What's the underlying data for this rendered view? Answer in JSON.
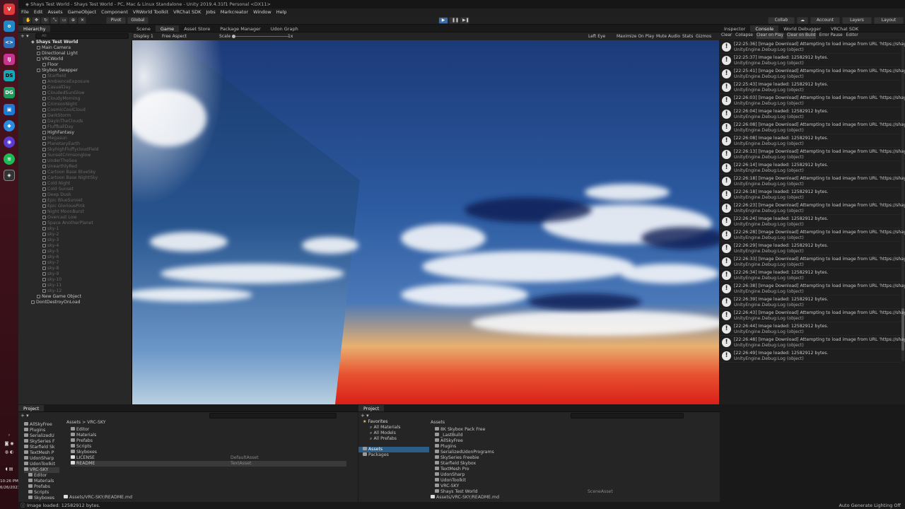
{
  "window_title": "Shays Test World - Shays Test World - PC, Mac & Linux Standalone - Unity 2019.4.31f1 Personal <DX11>",
  "menu": [
    "File",
    "Edit",
    "Assets",
    "GameObject",
    "Component",
    "VRWorld Toolkit",
    "VRChat SDK",
    "Jobs",
    "Markcreator",
    "Window",
    "Help"
  ],
  "toolbar": {
    "pivot_label": "Pivot",
    "global_label": "Global",
    "collab_label": "Collab",
    "account_label": "Account",
    "layers_label": "Layers",
    "layout_label": "Layout"
  },
  "hierarchy": {
    "tab_label": "Hierarchy",
    "search_placeholder": "All",
    "scene_name": "Shays Test World",
    "items": [
      {
        "label": "Main Camera",
        "indent": 2,
        "dim": false
      },
      {
        "label": "Directional Light",
        "indent": 2,
        "dim": false
      },
      {
        "label": "VRCWorld",
        "indent": 2,
        "dim": false
      },
      {
        "label": "Floor",
        "indent": 3,
        "dim": false
      },
      {
        "label": "Skybox Swapper",
        "indent": 2,
        "dim": false
      },
      {
        "label": "Starfield",
        "indent": 3,
        "dim": true
      },
      {
        "label": "AmbienceExposure",
        "indent": 3,
        "dim": true
      },
      {
        "label": "CasualDay",
        "indent": 3,
        "dim": true
      },
      {
        "label": "CloudedSunGlow",
        "indent": 3,
        "dim": true
      },
      {
        "label": "CloudyMorning",
        "indent": 3,
        "dim": true
      },
      {
        "label": "CrimsonNight",
        "indent": 3,
        "dim": true
      },
      {
        "label": "CosmicCoolCloud",
        "indent": 3,
        "dim": true
      },
      {
        "label": "DarkStorm",
        "indent": 3,
        "dim": true
      },
      {
        "label": "DayInTheClouds",
        "indent": 3,
        "dim": true
      },
      {
        "label": "FluffballDay",
        "indent": 3,
        "dim": true
      },
      {
        "label": "HighFantasy",
        "indent": 3,
        "dim": false
      },
      {
        "label": "Megasun",
        "indent": 3,
        "dim": true
      },
      {
        "label": "PlanetaryEarth",
        "indent": 3,
        "dim": true
      },
      {
        "label": "SkyhighFluffycloudField",
        "indent": 3,
        "dim": true
      },
      {
        "label": "SunsetCrimsonglow",
        "indent": 3,
        "dim": true
      },
      {
        "label": "UnderTheSea",
        "indent": 3,
        "dim": true
      },
      {
        "label": "UnearthlyRed",
        "indent": 3,
        "dim": true
      },
      {
        "label": "Cartoon Base BlueSky",
        "indent": 3,
        "dim": true
      },
      {
        "label": "Cartoon Base NightSky",
        "indent": 3,
        "dim": true
      },
      {
        "label": "Cold Night",
        "indent": 3,
        "dim": true
      },
      {
        "label": "Cold Sunset",
        "indent": 3,
        "dim": true
      },
      {
        "label": "Deep Dusk",
        "indent": 3,
        "dim": true
      },
      {
        "label": "Epic BlueSunset",
        "indent": 3,
        "dim": true
      },
      {
        "label": "Epic GloriousPink",
        "indent": 3,
        "dim": true
      },
      {
        "label": "Night MoonBurst",
        "indent": 3,
        "dim": true
      },
      {
        "label": "Overcast Low",
        "indent": 3,
        "dim": true
      },
      {
        "label": "Space AnotherPlanet",
        "indent": 3,
        "dim": true
      },
      {
        "label": "sky-1",
        "indent": 3,
        "dim": true
      },
      {
        "label": "sky-2",
        "indent": 3,
        "dim": true
      },
      {
        "label": "sky-3",
        "indent": 3,
        "dim": true
      },
      {
        "label": "sky-4",
        "indent": 3,
        "dim": true
      },
      {
        "label": "sky-5",
        "indent": 3,
        "dim": true
      },
      {
        "label": "sky-6",
        "indent": 3,
        "dim": true
      },
      {
        "label": "sky-7",
        "indent": 3,
        "dim": true
      },
      {
        "label": "sky-8",
        "indent": 3,
        "dim": true
      },
      {
        "label": "sky-9",
        "indent": 3,
        "dim": true
      },
      {
        "label": "sky-10",
        "indent": 3,
        "dim": true
      },
      {
        "label": "sky-11",
        "indent": 3,
        "dim": true
      },
      {
        "label": "sky-12",
        "indent": 3,
        "dim": true
      },
      {
        "label": "New Game Object",
        "indent": 2,
        "dim": false
      },
      {
        "label": "DontDestroyOnLoad",
        "indent": 1,
        "dim": false
      }
    ]
  },
  "view_tabs": [
    "Scene",
    "Game",
    "Asset Store",
    "Package Manager",
    "Udon Graph"
  ],
  "game_bar": {
    "display": "Display 1",
    "aspect": "Free Aspect",
    "scale_label": "Scale",
    "scale_value": "1x",
    "eye": "Left Eye",
    "maximize": "Maximize On Play",
    "mute": "Mute Audio",
    "stats": "Stats",
    "gizmos": "Gizmos"
  },
  "right_tabs": [
    "Inspector",
    "Console",
    "World Debugger",
    "VRChat SDK"
  ],
  "console_bar": [
    "Clear",
    "Collapse",
    "Clear on Play",
    "Clear on Build",
    "Error Pause",
    "Editor"
  ],
  "console": [
    {
      "l1": "[22:25:36] [Image Download] Attempting to load image from URL 'https://shaybox.git",
      "l2": "UnityEngine.Debug:Log (object)"
    },
    {
      "l1": "[22:25:37] Image loaded: 12582912 bytes.",
      "l2": "UnityEngine.Debug:Log (object)"
    },
    {
      "l1": "[22:25:41] [Image Download] Attempting to load image from URL 'https://shaybox.git",
      "l2": "UnityEngine.Debug:Log (object)"
    },
    {
      "l1": "[22:25:43] Image loaded: 12582912 bytes.",
      "l2": "UnityEngine.Debug:Log (object)"
    },
    {
      "l1": "[22:26:03] [Image Download] Attempting to load image from URL 'https://shaybox.git",
      "l2": "UnityEngine.Debug:Log (object)"
    },
    {
      "l1": "[22:26:04] Image loaded: 12582912 bytes.",
      "l2": "UnityEngine.Debug:Log (object)"
    },
    {
      "l1": "[22:26:08] [Image Download] Attempting to load image from URL 'https://shaybox.git",
      "l2": "UnityEngine.Debug:Log (object)"
    },
    {
      "l1": "[22:26:08] Image loaded: 12582912 bytes.",
      "l2": "UnityEngine.Debug:Log (object)"
    },
    {
      "l1": "[22:26:13] [Image Download] Attempting to load image from URL 'https://shaybox.git",
      "l2": "UnityEngine.Debug:Log (object)"
    },
    {
      "l1": "[22:26:14] Image loaded: 12582912 bytes.",
      "l2": "UnityEngine.Debug:Log (object)"
    },
    {
      "l1": "[22:26:18] [Image Download] Attempting to load image from URL 'https://shaybox.git",
      "l2": "UnityEngine.Debug:Log (object)"
    },
    {
      "l1": "[22:26:18] Image loaded: 12582912 bytes.",
      "l2": "UnityEngine.Debug:Log (object)"
    },
    {
      "l1": "[22:26:23] [Image Download] Attempting to load image from URL 'https://shaybox.git",
      "l2": "UnityEngine.Debug:Log (object)"
    },
    {
      "l1": "[22:26:24] Image loaded: 12582912 bytes.",
      "l2": "UnityEngine.Debug:Log (object)"
    },
    {
      "l1": "[22:26:28] [Image Download] Attempting to load image from URL 'https://shaybox.git",
      "l2": "UnityEngine.Debug:Log (object)"
    },
    {
      "l1": "[22:26:29] Image loaded: 12582912 bytes.",
      "l2": "UnityEngine.Debug:Log (object)"
    },
    {
      "l1": "[22:26:33] [Image Download] Attempting to load image from URL 'https://shaybox.git",
      "l2": "UnityEngine.Debug:Log (object)"
    },
    {
      "l1": "[22:26:34] Image loaded: 12582912 bytes.",
      "l2": "UnityEngine.Debug:Log (object)"
    },
    {
      "l1": "[22:26:38] [Image Download] Attempting to load image from URL 'https://shaybox.git",
      "l2": "UnityEngine.Debug:Log (object)"
    },
    {
      "l1": "[22:26:39] Image loaded: 12582912 bytes.",
      "l2": "UnityEngine.Debug:Log (object)"
    },
    {
      "l1": "[22:26:43] [Image Download] Attempting to load image from URL 'https://shaybox.git",
      "l2": "UnityEngine.Debug:Log (object)"
    },
    {
      "l1": "[22:26:44] Image loaded: 12582912 bytes.",
      "l2": "UnityEngine.Debug:Log (object)"
    },
    {
      "l1": "[22:26:48] [Image Download] Attempting to load image from URL 'https://shaybox.git",
      "l2": "UnityEngine.Debug:Log (object)"
    },
    {
      "l1": "[22:26:49] Image loaded: 12582912 bytes.",
      "l2": "UnityEngine.Debug:Log (object)"
    }
  ],
  "project_left": {
    "tab_label": "Project",
    "tree": [
      "AllSkyFree",
      "Plugins",
      "SerializedU",
      "SkySeries F",
      "Starfield Sk",
      "TextMesh P",
      "UdonSharp",
      "UdonToolkit",
      "VRC-SKY",
      "Editor",
      "Materials",
      "Prefabs",
      "Scripts",
      "Skyboxes"
    ],
    "breadcrumb": "Assets > VRC-SKY",
    "items": [
      {
        "name": "Editor",
        "type": ""
      },
      {
        "name": "Materials",
        "type": ""
      },
      {
        "name": "Prefabs",
        "type": ""
      },
      {
        "name": "Scripts",
        "type": ""
      },
      {
        "name": "Skyboxes",
        "type": ""
      },
      {
        "name": "LICENSE",
        "type": "DefaultAsset"
      },
      {
        "name": "README",
        "type": "TextAsset"
      }
    ],
    "path": "Assets/VRC-SKY/README.md"
  },
  "project_right": {
    "tab_label": "Project",
    "favorites_label": "Favorites",
    "favorites": [
      "All Materials",
      "All Models",
      "All Prefabs"
    ],
    "assets_label": "Assets",
    "packages_label": "Packages",
    "header": "Assets",
    "items": [
      {
        "name": "8K Skybox Pack Free",
        "type": ""
      },
      {
        "name": "_LastBuild",
        "type": ""
      },
      {
        "name": "AllSkyFree",
        "type": ""
      },
      {
        "name": "Plugins",
        "type": ""
      },
      {
        "name": "SerializedUdonPrograms",
        "type": ""
      },
      {
        "name": "SkySeries Freebie",
        "type": ""
      },
      {
        "name": "Starfield Skybox",
        "type": ""
      },
      {
        "name": "TextMesh Pro",
        "type": ""
      },
      {
        "name": "UdonSharp",
        "type": ""
      },
      {
        "name": "UdonToolkit",
        "type": ""
      },
      {
        "name": "VRC-SKY",
        "type": ""
      },
      {
        "name": "Shays Test World",
        "type": "SceneAsset"
      }
    ],
    "path": "Assets/VRC-SKY/README.md"
  },
  "status": {
    "message": "Image loaded: 12582912 bytes.",
    "right": "Auto Generate Lighting Off"
  },
  "clock": {
    "time": "10:26 PM",
    "date": "6/26/2023"
  },
  "colors": {
    "selected": "#2c5d87",
    "accent": "#4a90d9",
    "warn": "#e8e8e8",
    "taskbar": "#4a1420"
  }
}
